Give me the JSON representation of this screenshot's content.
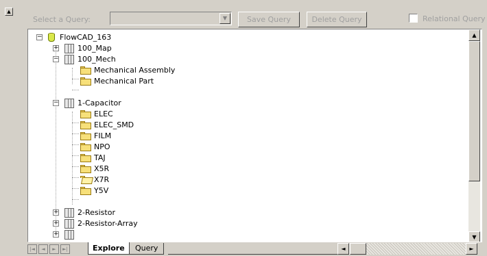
{
  "toolbar": {
    "query_label": "Select a Query:",
    "query_value": "",
    "save_label": "Save Query",
    "delete_label": "Delete Query",
    "relational_label": "Relational Query",
    "relational_checked": false
  },
  "tree": {
    "root": "FlowCAD_163",
    "groups": [
      {
        "label": "100_Map",
        "expanded": false,
        "children": []
      },
      {
        "label": "100_Mech",
        "expanded": true,
        "children": [
          "Mechanical Assembly",
          "Mechanical Part"
        ]
      },
      {
        "label": "1-Capacitor",
        "expanded": true,
        "children": [
          "ELEC",
          "ELEC_SMD",
          "FILM",
          "NPO",
          "TAJ",
          "X5R",
          "X7R",
          "Y5V"
        ]
      },
      {
        "label": "2-Resistor",
        "expanded": false,
        "children": []
      },
      {
        "label": "2-Resistor-Array",
        "expanded": false,
        "children": []
      }
    ]
  },
  "tabs": {
    "explore": "Explore",
    "query": "Query"
  },
  "icons": {
    "expander_collapsed": "+",
    "expander_expanded": "−",
    "scroll_up": "▲",
    "scroll_down": "▼",
    "scroll_left": "◄",
    "scroll_right": "►",
    "dropdown": "▼",
    "nav_first": "|◄",
    "nav_prev": "◄",
    "nav_next": "►",
    "nav_last": "►|"
  }
}
